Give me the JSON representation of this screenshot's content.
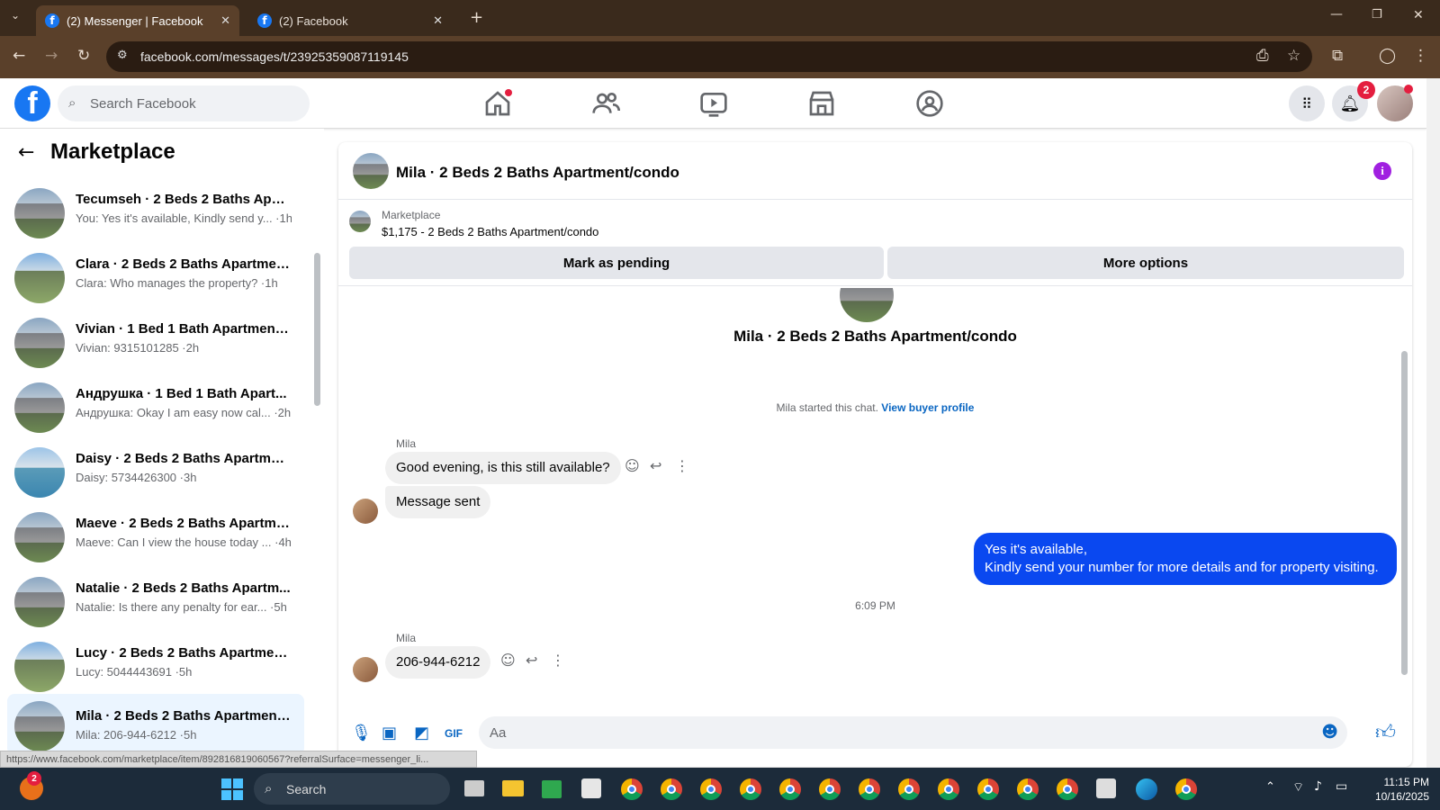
{
  "browser": {
    "tabs": [
      {
        "title": "(2) Messenger | Facebook"
      },
      {
        "title": "(2) Facebook"
      }
    ],
    "url": "facebook.com/messages/t/23925359087119145"
  },
  "fb": {
    "search_placeholder": "Search Facebook",
    "notif_count": "2"
  },
  "sidebar": {
    "title": "Marketplace",
    "conversations": [
      {
        "name": "Tecumseh · 2 Beds 2 Baths Apart...",
        "preview": "You: Yes it's available, Kindly send y... ·1h"
      },
      {
        "name": "Clara · 2 Beds 2 Baths Apartmen...",
        "preview": "Clara: Who manages the property? ·1h"
      },
      {
        "name": "Vivian · 1 Bed 1 Bath Apartment/...",
        "preview": "Vivian: 9315101285 ·2h"
      },
      {
        "name": "Андрушка · 1 Bed 1 Bath Apart...",
        "preview": "Андрушка: Okay I am easy now cal... ·2h"
      },
      {
        "name": "Daisy · 2 Beds 2 Baths Apartmen...",
        "preview": "Daisy: 5734426300 ·3h"
      },
      {
        "name": "Maeve · 2 Beds 2 Baths Apartme...",
        "preview": "Maeve: Can I view the house today ... ·4h"
      },
      {
        "name": "Natalie · 2 Beds 2 Baths Apartm...",
        "preview": "Natalie: Is there any penalty for ear... ·5h"
      },
      {
        "name": "Lucy · 2 Beds 2 Baths Apartment...",
        "preview": "Lucy: 5044443691 ·5h"
      },
      {
        "name": "Mila · 2 Beds 2 Baths Apartment...",
        "preview": "Mila: 206-944-6212 ·5h"
      }
    ]
  },
  "chat": {
    "title": "Mila · 2 Beds 2 Baths Apartment/condo",
    "listing_label": "Marketplace",
    "listing_price": "$1,175 - 2 Beds 2 Baths Apartment/condo",
    "btn_pending": "Mark as pending",
    "btn_more": "More options",
    "center_title": "Mila · 2 Beds 2 Baths Apartment/condo",
    "started": "Mila started this chat.",
    "view_profile": "View buyer profile",
    "sender": "Mila",
    "msg1": "Good evening, is this still available?",
    "msg2": "Message sent",
    "out1_line1": "Yes it's available,",
    "out1_line2": "Kindly send your number for more details and for property visiting.",
    "timestamp": "6:09 PM",
    "msg3": "206-944-6212",
    "composer_placeholder": "Aa"
  },
  "status_url": "https://www.facebook.com/marketplace/item/892816819060567?referralSurface=messenger_li...",
  "taskbar": {
    "search": "Search",
    "time": "11:15 PM",
    "date": "10/16/2025",
    "badge": "2"
  }
}
